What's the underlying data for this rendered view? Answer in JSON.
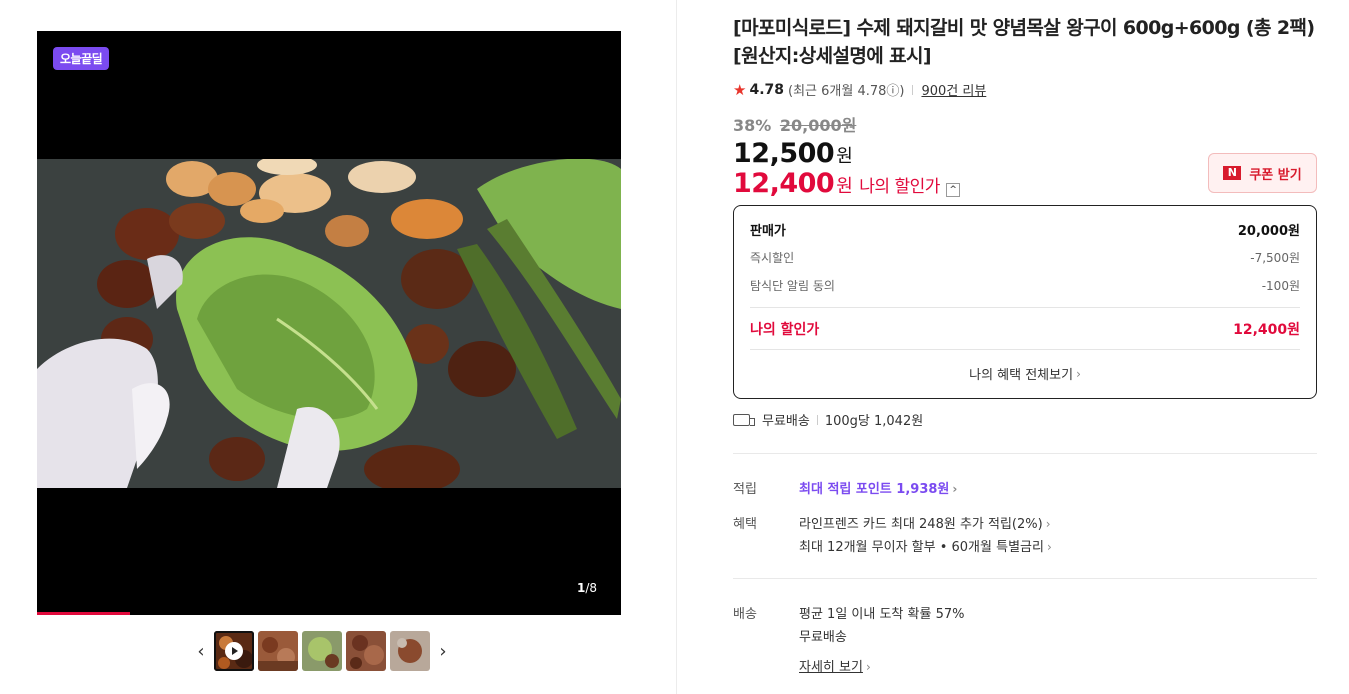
{
  "media": {
    "badge": "오늘끝딜",
    "counter_current": "1",
    "counter_total": "/8",
    "progress_fraction": 0.16,
    "thumbnails": [
      {
        "name": "video",
        "active": true
      },
      {
        "name": "image-2",
        "active": false
      },
      {
        "name": "image-3",
        "active": false
      },
      {
        "name": "image-4",
        "active": false
      },
      {
        "name": "image-5",
        "active": false
      }
    ],
    "prev_icon": "chevron-left-icon",
    "next_icon": "chevron-right-icon"
  },
  "product": {
    "title": "[마포미식로드] 수제 돼지갈비 맛 양념목살 왕구이 600g+600g (총 2팩) [원산지:상세설명에 표시]",
    "rating": "4.78",
    "rating_recent": "(최근 6개월 4.78ⓘ)",
    "review_count": "900건 리뷰",
    "discount_rate": "38%",
    "original_price": "20,000원",
    "price": "12,500",
    "price_unit": "원",
    "my_price": "12,400",
    "my_price_unit": "원",
    "my_price_label": "나의 할인가",
    "coupon_label": "쿠폰 받기",
    "coupon_icon": "N"
  },
  "breakdown": {
    "sale_label": "판매가",
    "sale_value": "20,000원",
    "items": [
      {
        "label": "즉시할인",
        "value": "-7,500원"
      },
      {
        "label": "탐식단 알림 동의",
        "value": "-100원"
      }
    ],
    "total_label": "나의 할인가",
    "total_value": "12,400원",
    "more_label": "나의 혜택 전체보기"
  },
  "shipping_summary": {
    "free": "무료배송",
    "unit_price": "100g당 1,042원"
  },
  "benefits": {
    "points_label": "적립",
    "points_value": "최대 적립 포인트 1,938원",
    "perks_label": "혜택",
    "perk_1": "라인프렌즈 카드 최대 248원 추가 적립(2%)",
    "perk_2": "최대 12개월 무이자 할부 • 60개월 특별금리"
  },
  "delivery": {
    "label": "배송",
    "arrival": "평균 1일 이내 도착 확률 57%",
    "fee": "무료배송",
    "details": "자세히 보기"
  },
  "colors": {
    "accent_red": "#e10a3c",
    "badge_purple": "#7b4bf0"
  }
}
